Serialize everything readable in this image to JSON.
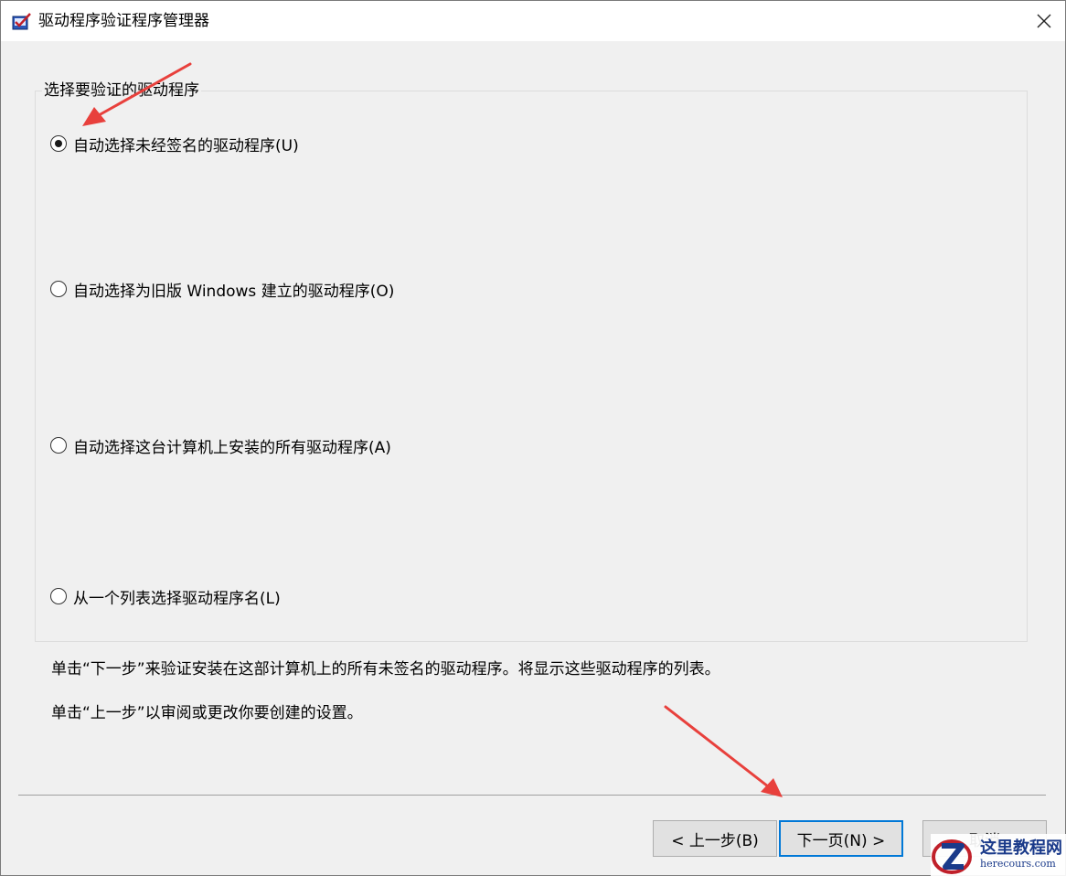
{
  "window": {
    "title": "驱动程序验证程序管理器",
    "icon": "driver-verifier-app-icon"
  },
  "group": {
    "label": "选择要验证的驱动程序",
    "options": [
      {
        "label": "自动选择未经签名的驱动程序(U)",
        "checked": true
      },
      {
        "label": "自动选择为旧版 Windows 建立的驱动程序(O)",
        "checked": false
      },
      {
        "label": "自动选择这台计算机上安装的所有驱动程序(A)",
        "checked": false
      },
      {
        "label": "从一个列表选择驱动程序名(L)",
        "checked": false
      }
    ]
  },
  "description": {
    "next_hint": "单击“下一步”来验证安装在这部计算机上的所有未签名的驱动程序。将显示这些驱动程序的列表。",
    "back_hint": "单击“上一步”以审阅或更改你要创建的设置。"
  },
  "buttons": {
    "back": "< 上一步(B)",
    "next": "下一页(N) >",
    "cancel": "取消"
  },
  "watermark": {
    "name": "这里教程网",
    "url": "herecours.com"
  },
  "colors": {
    "annotation_arrow": "#e8403c",
    "default_button_border": "#0078d7",
    "dialog_background": "#f0f0f0"
  }
}
